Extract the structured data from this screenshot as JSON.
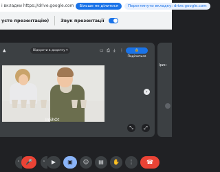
{
  "share_bar": {
    "message": "і вкладки https://drive.google.com",
    "stop_label": "Більше не ділитися",
    "switch_label": "Переглянути вкладку: drive.google.com"
  },
  "presentation_bar": {
    "stop_label": "усте презентацію)",
    "audio_label": "Звук презентації",
    "audio_on": true
  },
  "viewer": {
    "open_with_label": "Відкрити в додатку",
    "share_label": "Поділитися",
    "caption": "InShOt"
  },
  "side_participant": {
    "name": "Ірин"
  },
  "icons": {
    "drive": "google-drive-icon",
    "open_with_chevron": "chevron-down-icon",
    "comment": "comment-icon",
    "print": "print-icon",
    "download": "download-icon",
    "more": "more-vert-icon",
    "share_lock": "lock-icon",
    "next": "chevron-right-icon",
    "pin": "pin-icon",
    "fullscreen": "fullscreen-icon",
    "mic_off": "mic-off-icon",
    "camera": "videocam-icon",
    "present": "present-to-all-icon",
    "emoji": "emoji-icon",
    "captions": "captions-icon",
    "raise_hand": "raise-hand-icon",
    "more_options": "more-vert-icon",
    "end_call": "call-end-icon"
  },
  "colors": {
    "accent": "#1a73e8",
    "muted_red": "#ea4335",
    "presenting_blue": "#8ab4f8",
    "meet_bg": "#202124"
  }
}
